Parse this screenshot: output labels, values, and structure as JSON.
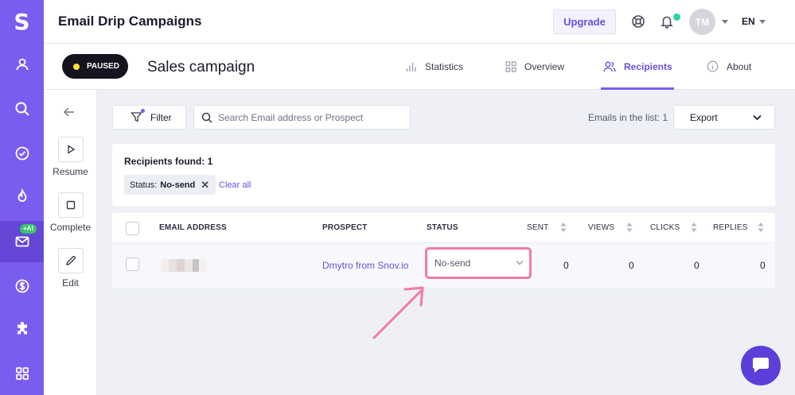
{
  "sidebar": {
    "logo": "S",
    "items": [
      {
        "icon": "user-icon"
      },
      {
        "icon": "search-icon"
      },
      {
        "icon": "check-circle-icon"
      },
      {
        "icon": "flame-icon"
      },
      {
        "icon": "mail-icon",
        "badge": "+AI",
        "active": true
      },
      {
        "icon": "dollar-icon"
      },
      {
        "icon": "puzzle-icon"
      },
      {
        "icon": "grid-icon"
      }
    ]
  },
  "header": {
    "title": "Email Drip Campaigns",
    "upgrade_label": "Upgrade",
    "avatar_initials": "TM",
    "language": "EN"
  },
  "campaign": {
    "status": "PAUSED",
    "name": "Sales campaign",
    "tabs": [
      {
        "label": "Statistics",
        "icon": "bar-chart-icon"
      },
      {
        "label": "Overview",
        "icon": "grid-icon"
      },
      {
        "label": "Recipients",
        "icon": "users-icon",
        "active": true
      },
      {
        "label": "About",
        "icon": "info-icon"
      }
    ]
  },
  "actions": {
    "resume_label": "Resume",
    "complete_label": "Complete",
    "edit_label": "Edit"
  },
  "toolbar": {
    "filter_label": "Filter",
    "search_placeholder": "Search Email address or Prospect",
    "emails_in_list": "Emails in the list: 1",
    "export_label": "Export"
  },
  "filters": {
    "found_label": "Recipients found: 1",
    "chip_key": "Status:",
    "chip_value": "No-send",
    "clear_all_label": "Clear all"
  },
  "table": {
    "columns": [
      "EMAIL ADDRESS",
      "PROSPECT",
      "STATUS",
      "SENT",
      "VIEWS",
      "CLICKS",
      "REPLIES"
    ],
    "rows": [
      {
        "prospect": "Dmytro from Snov.io",
        "status": "No-send",
        "sent": "0",
        "views": "0",
        "clicks": "0",
        "replies": "0"
      }
    ]
  },
  "colors": {
    "brand": "#7b5cf0",
    "accent_text": "#6a4fe0",
    "highlight": "#f07aa8",
    "notification": "#2ed3a2"
  }
}
